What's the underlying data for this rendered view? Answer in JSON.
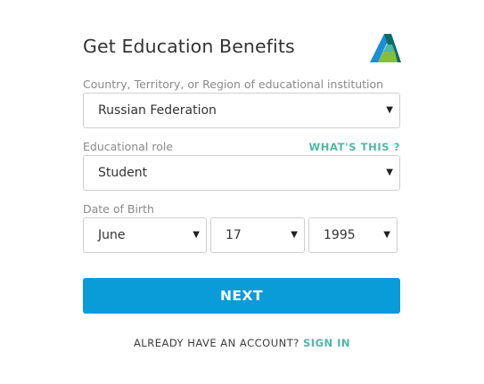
{
  "header": {
    "title": "Get Education Benefits",
    "logo_icon": "autodesk-logo-icon"
  },
  "country": {
    "label": "Country, Territory, or Region of educational institution",
    "value": "Russian Federation"
  },
  "role": {
    "label": "Educational role",
    "help_link": "WHAT'S THIS ?",
    "value": "Student"
  },
  "dob": {
    "label": "Date of Birth",
    "month": "June",
    "day": "17",
    "year": "1995"
  },
  "actions": {
    "next_label": "NEXT"
  },
  "signin": {
    "prompt": "ALREADY HAVE AN ACCOUNT?",
    "link": "SIGN IN"
  },
  "colors": {
    "accent_teal": "#4fb9a2",
    "button_blue": "#0a9bd9"
  }
}
